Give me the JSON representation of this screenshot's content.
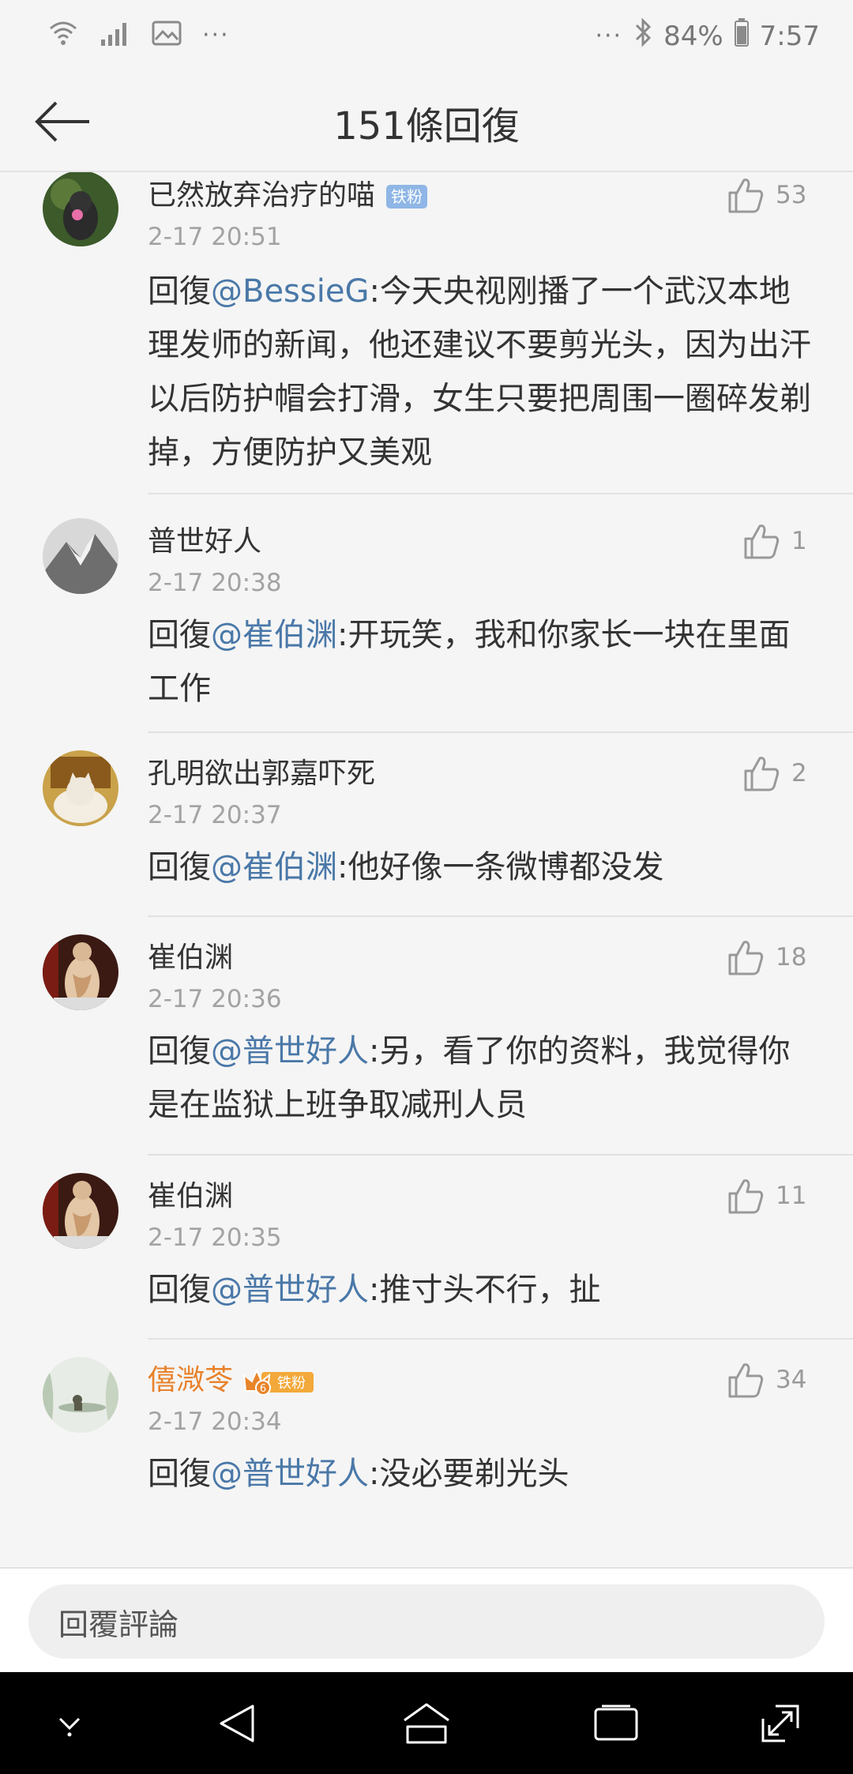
{
  "status_bar": {
    "left_dots": "···",
    "right_dots": "···",
    "battery_percent": "84%",
    "time": "7:57"
  },
  "header": {
    "title": "151條回復"
  },
  "reply_prefix": "回復",
  "comments": [
    {
      "name": "已然放弃治疗的喵",
      "badge": "铁粉",
      "time": "2-17 20:51",
      "mention": "@BessieG",
      "text": ":今天央视刚播了一个武汉本地理发师的新闻，他还建议不要剪光头，因为出汗以后防护帽会打滑，女生只要把周围一圈碎发剃掉，方便防护又美观",
      "likes": "53"
    },
    {
      "name": "普世好人",
      "time": "2-17 20:38",
      "mention": "@崔伯渊",
      "text": ":开玩笑，我和你家长一块在里面工作",
      "likes": "1"
    },
    {
      "name": "孔明欲出郭嘉吓死",
      "time": "2-17 20:37",
      "mention": "@崔伯渊",
      "text": ":他好像一条微博都没发",
      "likes": "2"
    },
    {
      "name": "崔伯渊",
      "time": "2-17 20:36",
      "mention": "@普世好人",
      "text": ":另，看了你的资料，我觉得你是在监狱上班争取减刑人员",
      "likes": "18"
    },
    {
      "name": "崔伯渊",
      "time": "2-17 20:35",
      "mention": "@普世好人",
      "text": ":推寸头不行，扯",
      "likes": "11"
    },
    {
      "name": "僖溦苓",
      "badge": "铁粉",
      "vip_level": "6",
      "time": "2-17 20:34",
      "mention": "@普世好人",
      "text": ":没必要剃光头",
      "likes": "34"
    }
  ],
  "reply_bar": {
    "placeholder": "回覆評論"
  },
  "colors": {
    "mention": "#4a78a8",
    "vip_name": "#e8812a",
    "tie_badge": "#8fb6e6"
  }
}
